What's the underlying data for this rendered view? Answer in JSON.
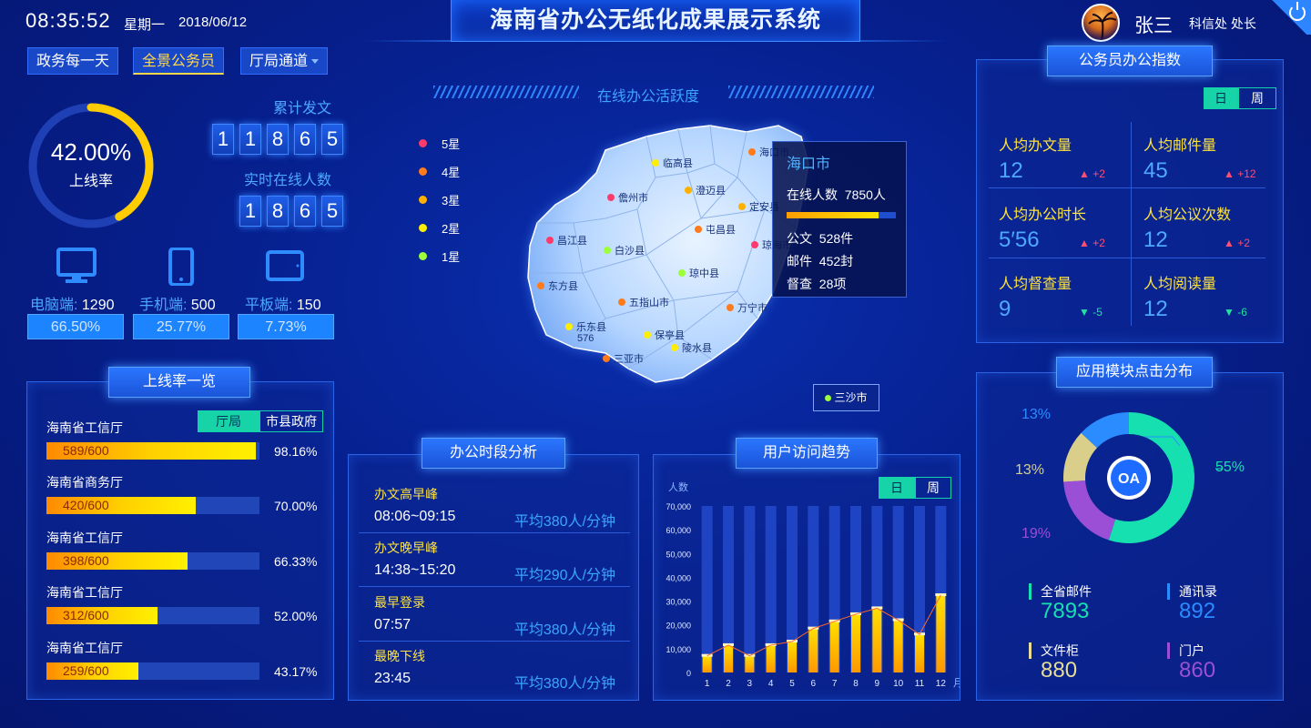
{
  "header": {
    "time": "08:35:52",
    "weekday": "星期一",
    "date": "2018/06/12",
    "title": "海南省办公无纸化成果展示系统",
    "user_name": "张三",
    "user_dept": "科信处 处长"
  },
  "nav": {
    "items": [
      "政务每一天",
      "全景公务员",
      "厅局通道"
    ],
    "active": "全景公务员"
  },
  "online_rate": {
    "percent": "42.00%",
    "label": "上线率",
    "value": 0.42
  },
  "counters": {
    "total_label": "累计发文",
    "total_digits": [
      "1",
      "1",
      "8",
      "6",
      "5"
    ],
    "online_label": "实时在线人数",
    "online_digits": [
      "1",
      "8",
      "6",
      "5"
    ]
  },
  "devices": [
    {
      "icon": "monitor-icon",
      "label": "电脑端:",
      "count": "1290",
      "percent": "66.50%"
    },
    {
      "icon": "phone-icon",
      "label": "手机端:",
      "count": "500",
      "percent": "25.77%"
    },
    {
      "icon": "tablet-icon",
      "label": "平板端:",
      "count": "150",
      "percent": "7.73%"
    }
  ],
  "online_list": {
    "title": "上线率一览",
    "tabs": [
      "厅局",
      "市县政府"
    ],
    "active_tab": "厅局",
    "items": [
      {
        "name": "海南省工信厅",
        "value": "589/600",
        "percent": "98.16%",
        "ratio": 0.9816
      },
      {
        "name": "海南省商务厅",
        "value": "420/600",
        "percent": "70.00%",
        "ratio": 0.7
      },
      {
        "name": "海南省工信厅",
        "value": "398/600",
        "percent": "66.33%",
        "ratio": 0.6633
      },
      {
        "name": "海南省工信厅",
        "value": "312/600",
        "percent": "52.00%",
        "ratio": 0.52
      },
      {
        "name": "海南省工信厅",
        "value": "259/600",
        "percent": "43.17%",
        "ratio": 0.4317
      }
    ]
  },
  "map": {
    "title": "在线办公活跃度",
    "legend": [
      {
        "label": "5星",
        "color": "#ff3b6b"
      },
      {
        "label": "4星",
        "color": "#ff7a1a"
      },
      {
        "label": "3星",
        "color": "#ffb000"
      },
      {
        "label": "2星",
        "color": "#ffee00"
      },
      {
        "label": "1星",
        "color": "#9cff3a"
      }
    ],
    "cities": [
      {
        "name": "临高县",
        "color": "#ffee00"
      },
      {
        "name": "海口市",
        "color": "#ff7a1a"
      },
      {
        "name": "儋州市",
        "color": "#ff3b6b"
      },
      {
        "name": "澄迈县",
        "color": "#ffb000"
      },
      {
        "name": "定安县",
        "color": "#ffb000"
      },
      {
        "name": "昌江县",
        "color": "#ff3b6b"
      },
      {
        "name": "白沙县",
        "color": "#9cff3a"
      },
      {
        "name": "屯昌县",
        "color": "#ff7a1a"
      },
      {
        "name": "琼海市",
        "color": "#ff3b6b"
      },
      {
        "name": "琼中县",
        "color": "#9cff3a"
      },
      {
        "name": "东方县",
        "color": "#ff7a1a"
      },
      {
        "name": "五指山市",
        "color": "#ff7a1a"
      },
      {
        "name": "万宁市",
        "color": "#ff7a1a"
      },
      {
        "name": "乐东县",
        "color": "#ffee00"
      },
      {
        "name": "保亭县",
        "color": "#ffee00"
      },
      {
        "name": "陵水县",
        "color": "#ffee00"
      },
      {
        "name": "三亚市",
        "color": "#ff7a1a"
      }
    ],
    "ledong_value": "576",
    "sansha": {
      "name": "三沙市",
      "color": "#9cff3a"
    },
    "tooltip": {
      "city": "海口市",
      "online_label": "在线人数",
      "online_value": "7850人",
      "docs_label": "公文",
      "docs_value": "528件",
      "mail_label": "邮件",
      "mail_value": "452封",
      "supervise_label": "督查",
      "supervise_value": "28项",
      "bar_ratio": 0.84
    }
  },
  "time_analysis": {
    "title": "办公时段分析",
    "rows": [
      {
        "label": "办文高早峰",
        "time": "08:06~09:15",
        "avg": "平均380人/分钟"
      },
      {
        "label": "办文晚早峰",
        "time": "14:38~15:20",
        "avg": "平均290人/分钟"
      },
      {
        "label": "最早登录",
        "time": "07:57",
        "avg": "平均380人/分钟"
      },
      {
        "label": "最晚下线",
        "time": "23:45",
        "avg": "平均380人/分钟"
      }
    ]
  },
  "trend": {
    "title": "用户访问趋势",
    "tabs": [
      "日",
      "周"
    ],
    "active_tab": "日"
  },
  "chart_data": {
    "type": "bar",
    "title": "用户访问趋势",
    "ylabel": "人数",
    "xlabel": "月份",
    "categories": [
      "1",
      "2",
      "3",
      "4",
      "5",
      "6",
      "7",
      "8",
      "9",
      "10",
      "11",
      "12"
    ],
    "values": [
      7000,
      11500,
      7000,
      11500,
      13000,
      18500,
      21500,
      24500,
      27000,
      22000,
      16000,
      32500
    ],
    "ylim": [
      0,
      70000
    ],
    "yticks": [
      "0",
      "10,000",
      "20,000",
      "30,000",
      "40,000",
      "50,000",
      "60,000",
      "70,000"
    ],
    "line_overlay": true
  },
  "index": {
    "title": "公务员办公指数",
    "tabs": [
      "日",
      "周"
    ],
    "active_tab": "日",
    "items": [
      {
        "name": "人均办文量",
        "value": "12",
        "delta": "+2",
        "dir": "up"
      },
      {
        "name": "人均邮件量",
        "value": "45",
        "delta": "+12",
        "dir": "up"
      },
      {
        "name": "人均办公时长",
        "value": "5′56",
        "delta": "+2",
        "dir": "up"
      },
      {
        "name": "人均公议次数",
        "value": "12",
        "delta": "+2",
        "dir": "up"
      },
      {
        "name": "人均督查量",
        "value": "9",
        "delta": "-5",
        "dir": "down"
      },
      {
        "name": "人均阅读量",
        "value": "12",
        "delta": "-6",
        "dir": "down"
      }
    ]
  },
  "modules": {
    "title": "应用模块点击分布",
    "center_label": "OA",
    "slices": [
      {
        "pct": "55%",
        "value": 55,
        "color": "#17e0b0"
      },
      {
        "pct": "19%",
        "value": 19,
        "color": "#9a4fd6"
      },
      {
        "pct": "13%",
        "value": 13,
        "color": "#d9cf8a"
      },
      {
        "pct": "13%",
        "value": 13,
        "color": "#2a8cff"
      }
    ],
    "legend": [
      {
        "name": "全省邮件",
        "value": "7893",
        "color": "#17e0b0"
      },
      {
        "name": "通讯录",
        "value": "892",
        "color": "#2a8cff"
      },
      {
        "name": "文件柜",
        "value": "880",
        "color": "#e8dd98"
      },
      {
        "name": "门户",
        "value": "860",
        "color": "#9a4fd6"
      }
    ]
  }
}
